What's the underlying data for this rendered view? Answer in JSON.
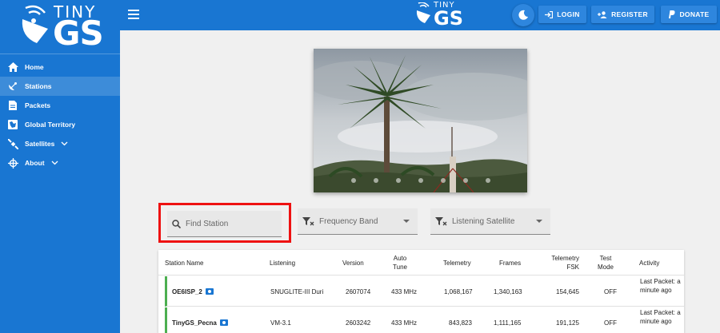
{
  "brand": {
    "tiny": "TINY",
    "gs": "GS"
  },
  "sidebar": {
    "items": [
      {
        "label": "Home",
        "icon": "home-icon"
      },
      {
        "label": "Stations",
        "icon": "satellite-dish-icon"
      },
      {
        "label": "Packets",
        "icon": "document-icon"
      },
      {
        "label": "Global Territory",
        "icon": "map-icon"
      },
      {
        "label": "Satellites",
        "icon": "satellite-icon"
      },
      {
        "label": "About",
        "icon": "compass-icon"
      }
    ]
  },
  "header": {
    "login": "LOGIN",
    "register": "REGISTER",
    "donate": "DONATE"
  },
  "filters": {
    "search_placeholder": "Find Station",
    "frequency_band": "Frequency Band",
    "listening_satellite": "Listening Satellite"
  },
  "table": {
    "headers": {
      "station_name": "Station Name",
      "listening": "Listening",
      "version": "Version",
      "auto_tune": "Auto Tune",
      "telemetry": "Telemetry",
      "frames": "Frames",
      "telemetry_fsk": "Telemetry FSK",
      "test_mode": "Test Mode",
      "activity": "Activity"
    },
    "rows": [
      {
        "name": "OE6ISP_2",
        "listening": "SNUGLITE-III Duri",
        "version": "2607074",
        "auto_tune": "433 MHz",
        "telemetry": "1,068,167",
        "frames": "1,340,163",
        "telemetry_fsk": "154,645",
        "test_mode": "OFF",
        "activity": "Last Packet: a minute ago"
      },
      {
        "name": "TinyGS_Pecna",
        "listening": "VM-3.1",
        "version": "2603242",
        "auto_tune": "433 MHz",
        "telemetry": "843,823",
        "frames": "1,111,165",
        "telemetry_fsk": "191,125",
        "test_mode": "OFF",
        "activity": "Last Packet: a minute ago"
      }
    ]
  },
  "colors": {
    "primary": "#1976d2",
    "button": "#2e86de",
    "highlight_border": "#ee1111",
    "row_accent": "#4caf50"
  }
}
